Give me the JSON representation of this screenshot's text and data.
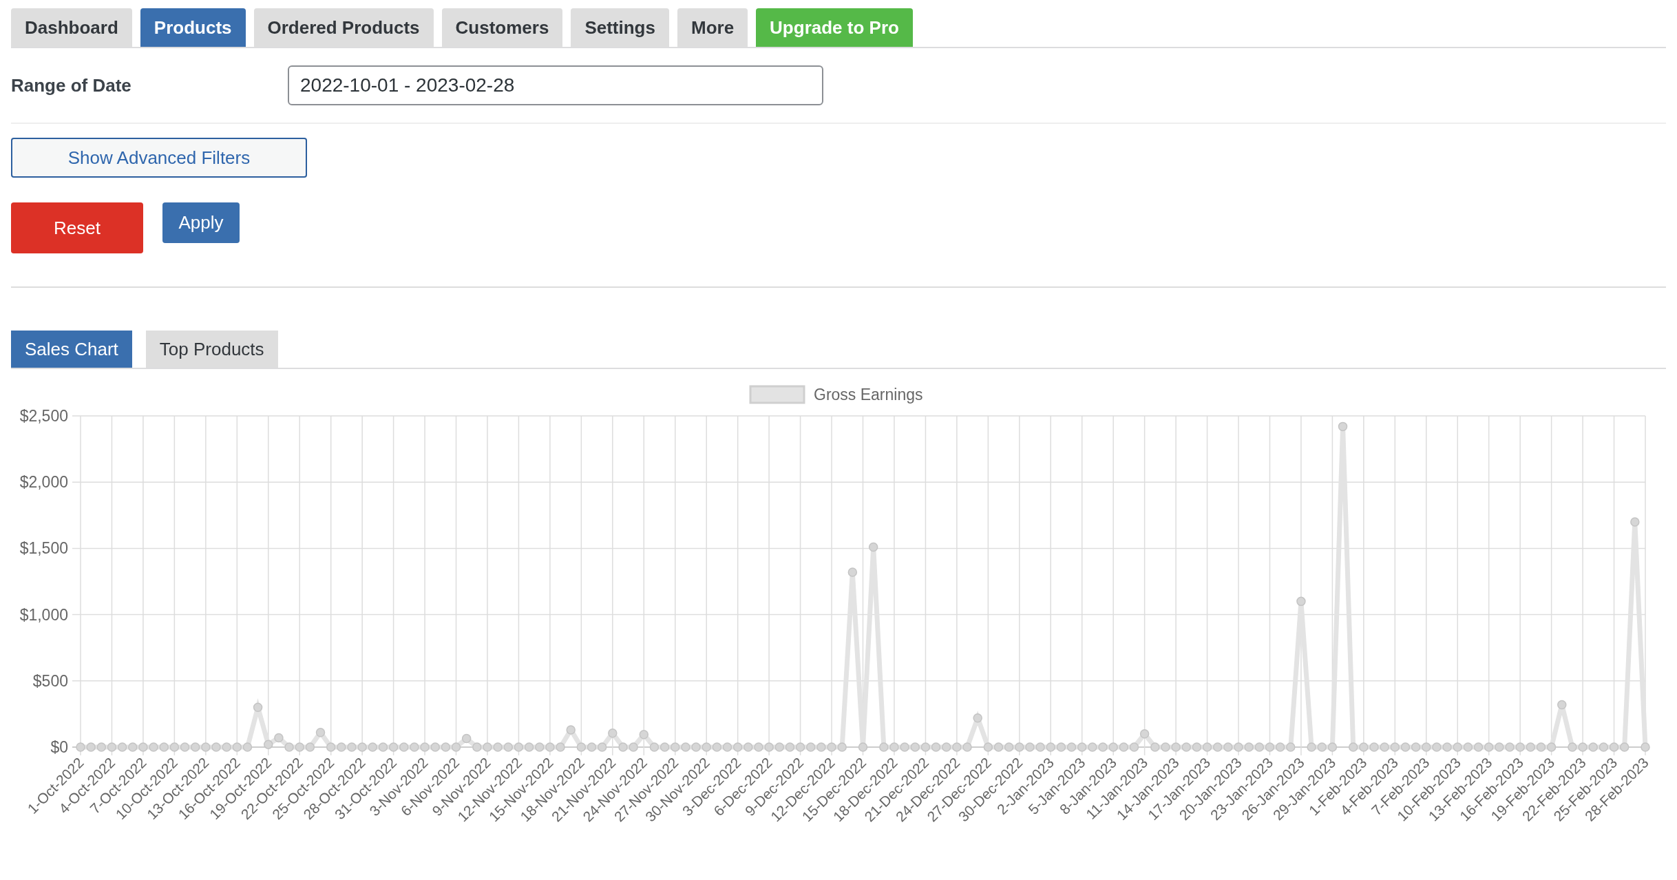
{
  "nav_tabs": [
    {
      "label": "Dashboard",
      "selected": false,
      "kind": "tab"
    },
    {
      "label": "Products",
      "selected": true,
      "kind": "tab"
    },
    {
      "label": "Ordered Products",
      "selected": false,
      "kind": "tab"
    },
    {
      "label": "Customers",
      "selected": false,
      "kind": "tab"
    },
    {
      "label": "Settings",
      "selected": false,
      "kind": "tab"
    },
    {
      "label": "More",
      "selected": false,
      "kind": "tab"
    },
    {
      "label": "Upgrade to Pro",
      "kind": "promo"
    }
  ],
  "filters": {
    "range_label": "Range of Date",
    "range_value": "2022-10-01 - 2023-02-28"
  },
  "buttons": [
    {
      "label": "Show Advanced Filters",
      "kind": "outline"
    },
    {
      "label": "Reset",
      "kind": "danger"
    },
    {
      "label": "Apply",
      "kind": "primary"
    }
  ],
  "chart_tabs": [
    {
      "label": "Sales Chart",
      "selected": true
    },
    {
      "label": "Top Products",
      "selected": false
    }
  ],
  "chart_data": {
    "type": "line",
    "grid": true,
    "ylim": [
      0,
      2500
    ],
    "categories": [
      "1-Oct-2022",
      null,
      null,
      "4-Oct-2022",
      null,
      null,
      "7-Oct-2022",
      null,
      null,
      "10-Oct-2022",
      null,
      null,
      "13-Oct-2022",
      null,
      null,
      "16-Oct-2022",
      null,
      null,
      "19-Oct-2022",
      null,
      null,
      "22-Oct-2022",
      null,
      null,
      "25-Oct-2022",
      null,
      null,
      "28-Oct-2022",
      null,
      null,
      "31-Oct-2022",
      null,
      null,
      "3-Nov-2022",
      null,
      null,
      "6-Nov-2022",
      null,
      null,
      "9-Nov-2022",
      null,
      null,
      "12-Nov-2022",
      null,
      null,
      "15-Nov-2022",
      null,
      null,
      "18-Nov-2022",
      null,
      null,
      "21-Nov-2022",
      null,
      null,
      "24-Nov-2022",
      null,
      null,
      "27-Nov-2022",
      null,
      null,
      "30-Nov-2022",
      null,
      null,
      "3-Dec-2022",
      null,
      null,
      "6-Dec-2022",
      null,
      null,
      "9-Dec-2022",
      null,
      null,
      "12-Dec-2022",
      null,
      null,
      "15-Dec-2022",
      null,
      null,
      "18-Dec-2022",
      null,
      null,
      "21-Dec-2022",
      null,
      null,
      "24-Dec-2022",
      null,
      null,
      "27-Dec-2022",
      null,
      null,
      "30-Dec-2022",
      null,
      null,
      "2-Jan-2023",
      null,
      null,
      "5-Jan-2023",
      null,
      null,
      "8-Jan-2023",
      null,
      null,
      "11-Jan-2023",
      null,
      null,
      "14-Jan-2023",
      null,
      null,
      "17-Jan-2023",
      null,
      null,
      "20-Jan-2023",
      null,
      null,
      "23-Jan-2023",
      null,
      null,
      "26-Jan-2023",
      null,
      null,
      "29-Jan-2023",
      null,
      null,
      "1-Feb-2023",
      null,
      null,
      "4-Feb-2023",
      null,
      null,
      "7-Feb-2023",
      null,
      null,
      "10-Feb-2023",
      null,
      null,
      "13-Feb-2023",
      null,
      null,
      "16-Feb-2023",
      null,
      null,
      "19-Feb-2023",
      null,
      null,
      "22-Feb-2023",
      null,
      null,
      "25-Feb-2023",
      null,
      null,
      "28-Feb-2023"
    ],
    "yticks": [
      {
        "value": 0,
        "label": "$0"
      },
      {
        "value": 500,
        "label": "$500"
      },
      {
        "value": 1000,
        "label": "$1,000"
      },
      {
        "value": 1500,
        "label": "$1,500"
      },
      {
        "value": 2000,
        "label": "$2,000"
      },
      {
        "value": 2500,
        "label": "$2,500"
      }
    ],
    "series": [
      {
        "name": "Gross Earnings",
        "color": "#e3e3e3",
        "marker": true,
        "values": [
          0,
          0,
          0,
          0,
          0,
          0,
          0,
          0,
          0,
          0,
          0,
          0,
          0,
          0,
          0,
          0,
          0,
          300,
          20,
          70,
          0,
          0,
          0,
          110,
          0,
          0,
          0,
          0,
          0,
          0,
          0,
          0,
          0,
          0,
          0,
          0,
          0,
          65,
          0,
          0,
          0,
          0,
          0,
          0,
          0,
          0,
          0,
          130,
          0,
          0,
          0,
          105,
          0,
          0,
          95,
          0,
          0,
          0,
          0,
          0,
          0,
          0,
          0,
          0,
          0,
          0,
          0,
          0,
          0,
          0,
          0,
          0,
          0,
          0,
          1320,
          0,
          1510,
          0,
          0,
          0,
          0,
          0,
          0,
          0,
          0,
          0,
          220,
          0,
          0,
          0,
          0,
          0,
          0,
          0,
          0,
          0,
          0,
          0,
          0,
          0,
          0,
          0,
          100,
          0,
          0,
          0,
          0,
          0,
          0,
          0,
          0,
          0,
          0,
          0,
          0,
          0,
          0,
          1100,
          0,
          0,
          0,
          2420,
          0,
          0,
          0,
          0,
          0,
          0,
          0,
          0,
          0,
          0,
          0,
          0,
          0,
          0,
          0,
          0,
          0,
          0,
          0,
          0,
          320,
          0,
          0,
          0,
          0,
          0,
          0,
          1700,
          0
        ]
      }
    ]
  }
}
